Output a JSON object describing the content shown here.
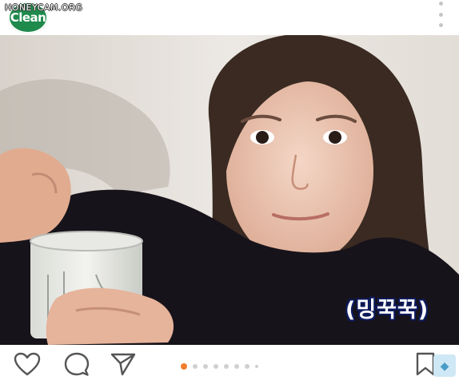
{
  "brand": {
    "logo_text": "Clean",
    "watermark": "HONEYCAM.ORG"
  },
  "photo": {
    "caption": "(밍꾹꾹)"
  },
  "actions": [
    {
      "name": "like",
      "icon": "heart-icon"
    },
    {
      "name": "comment",
      "icon": "comment-icon"
    },
    {
      "name": "share",
      "icon": "send-icon"
    },
    {
      "name": "save",
      "icon": "bookmark-icon"
    }
  ],
  "carousel": {
    "count": 8,
    "active_index": 0
  },
  "colors": {
    "accent": "#f07e2d",
    "logo_green": "#1e8a4c",
    "caption_outline": "#0d1b5e"
  }
}
